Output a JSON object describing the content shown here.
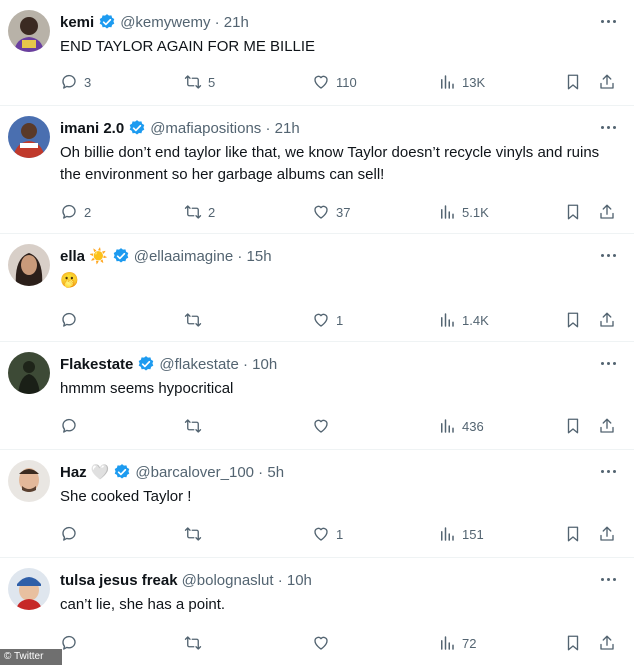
{
  "colors": {
    "text": "#0f1419",
    "secondary": "#536471",
    "verified": "#1d9bf0",
    "divider": "#eff3f4"
  },
  "tweets": [
    {
      "name": "kemi",
      "handle": "@kemywemy",
      "time": "21h",
      "emoji": "",
      "text": "END TAYLOR AGAIN FOR ME BILLIE",
      "replies": "3",
      "retweets": "5",
      "likes": "110",
      "views": "13K",
      "avatar": "profile-photo"
    },
    {
      "name": "imani 2.0",
      "handle": "@mafiapositions",
      "time": "21h",
      "emoji": "",
      "text": "Oh billie don’t end taylor like that, we know Taylor doesn’t recycle vinyls and ruins the environment so her garbage albums can sell!",
      "replies": "2",
      "retweets": "2",
      "likes": "37",
      "views": "5.1K",
      "avatar": "profile-photo"
    },
    {
      "name": "ella",
      "handle": "@ellaaimagine",
      "time": "15h",
      "emoji": "☀️",
      "text": "🫢",
      "replies": "",
      "retweets": "",
      "likes": "1",
      "views": "1.4K",
      "avatar": "profile-photo"
    },
    {
      "name": "Flakestate",
      "handle": "@flakestate",
      "time": "10h",
      "emoji": "",
      "text": "hmmm seems hypocritical",
      "replies": "",
      "retweets": "",
      "likes": "",
      "views": "436",
      "avatar": "profile-photo"
    },
    {
      "name": "Haz",
      "handle": "@barcalover_100",
      "time": "5h",
      "emoji": "🤍",
      "text": "She cooked Taylor !",
      "replies": "",
      "retweets": "",
      "likes": "1",
      "views": "151",
      "avatar": "profile-photo"
    },
    {
      "name": "tulsa jesus freak",
      "handle": "@bolognaslut",
      "time": "10h",
      "emoji": "",
      "text": "can’t lie, she has a point.",
      "replies": "",
      "retweets": "",
      "likes": "",
      "views": "72",
      "avatar": "profile-photo"
    }
  ],
  "watermark": "© Twitter"
}
